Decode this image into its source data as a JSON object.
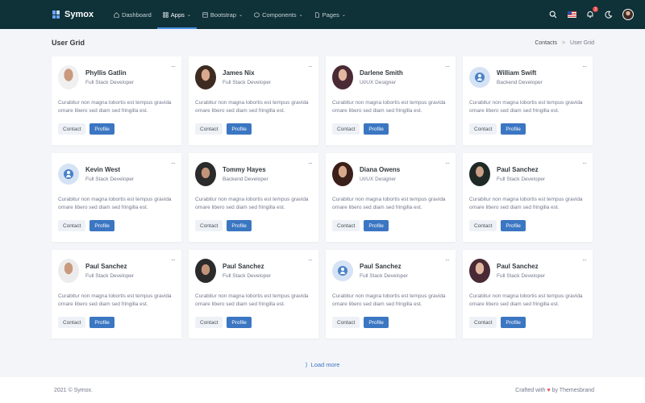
{
  "brand": "Symox",
  "nav": [
    {
      "label": "Dashboard",
      "icon": "home-icon"
    },
    {
      "label": "Apps",
      "icon": "grid-icon"
    },
    {
      "label": "Bootstrap",
      "icon": "layers-icon"
    },
    {
      "label": "Components",
      "icon": "box-icon"
    },
    {
      "label": "Pages",
      "icon": "file-icon"
    }
  ],
  "notifications_count": "3",
  "page_title": "User Grid",
  "breadcrumb": {
    "parent": "Contacts",
    "sep": ">",
    "current": "User Grid"
  },
  "users": [
    {
      "name": "Phyllis Gatlin",
      "role": "Full Stack Developer"
    },
    {
      "name": "James Nix",
      "role": "Full Stack Developer"
    },
    {
      "name": "Darlene Smith",
      "role": "UI/UX Designer"
    },
    {
      "name": "William Swift",
      "role": "Backend Developer"
    },
    {
      "name": "Kevin West",
      "role": "Full Stack Developer"
    },
    {
      "name": "Tommy Hayes",
      "role": "Backend Developer"
    },
    {
      "name": "Diana Owens",
      "role": "UI/UX Designer"
    },
    {
      "name": "Paul Sanchez",
      "role": "Full Stack Developer"
    },
    {
      "name": "Paul Sanchez",
      "role": "Full Stack Developer"
    },
    {
      "name": "Paul Sanchez",
      "role": "Full Stack Developer"
    },
    {
      "name": "Paul Sanchez",
      "role": "Full Stack Developer"
    },
    {
      "name": "Paul Sanchez",
      "role": "Full Stack Developer"
    }
  ],
  "card_desc": "Curabitur non magna lobortis est tempus gravida ornare libero sed diam sed fringilla est.",
  "contact_label": "Contact",
  "profile_label": "Profile",
  "more_label": "···",
  "load_more": "Load more",
  "footer_left": "2021 © Symox.",
  "footer_right_prefix": "Crafted with",
  "footer_right_suffix": "by Themesbrand",
  "colors": {
    "topbar": "#0f3138",
    "primary": "#3b76c2",
    "background": "#f3f5f8"
  }
}
